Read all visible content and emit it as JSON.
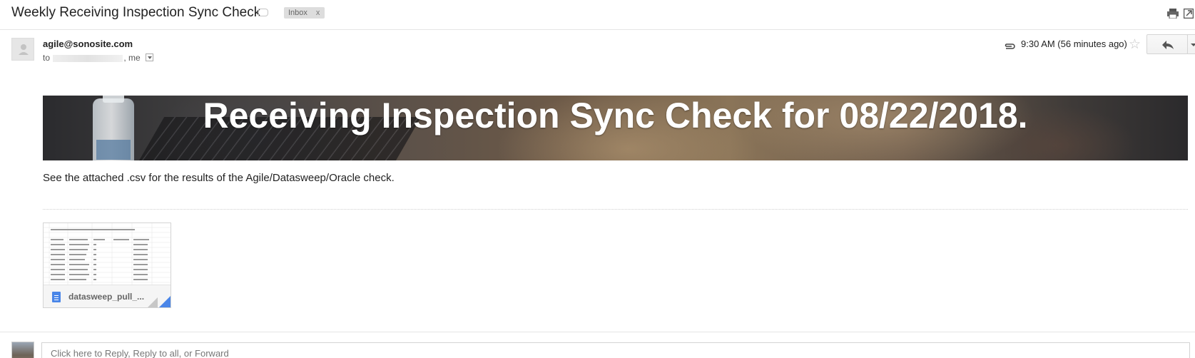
{
  "subject": {
    "title": "Weekly Receiving Inspection Sync Check",
    "label_chip": "Inbox",
    "label_remove": "x"
  },
  "message": {
    "sender": "agile@sonosite.com",
    "to_prefix": "to",
    "to_suffix": ", me",
    "timestamp": "9:30 AM (56 minutes ago)"
  },
  "banner": {
    "title": "Receiving Inspection Sync Check for 08/22/2018."
  },
  "body": {
    "text": "See the attached .csv for the results of the Agile/Datasweep/Oracle check."
  },
  "attachment": {
    "filename": "datasweep_pull_...",
    "icon": "spreadsheet-file-icon"
  },
  "reply": {
    "placeholder": "Click here to Reply, Reply to all, or Forward"
  },
  "icons": {
    "label": "label-tag-icon",
    "print": "print-icon",
    "new_window": "new-window-icon",
    "paperclip": "paperclip-icon",
    "star": "star-icon",
    "reply": "reply-arrow-icon",
    "more": "chevron-down-icon"
  },
  "colors": {
    "accent_blue": "#4a86e8",
    "chip_bg": "#dddddd",
    "banner_text": "#ffffff"
  }
}
